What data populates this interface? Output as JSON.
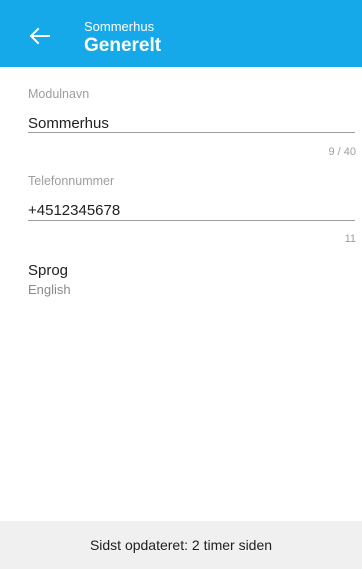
{
  "colors": {
    "appbar_background": "#16a9e9",
    "appbar_text": "#ffffff",
    "footer_background": "#f0f0f0"
  },
  "appbar": {
    "back_icon": "arrow-left-icon",
    "subtitle": "Sommerhus",
    "title": "Generelt"
  },
  "fields": {
    "module_name": {
      "label": "Modulnavn",
      "value": "Sommerhus",
      "counter": "9 / 40"
    },
    "phone_number": {
      "label": "Telefonnummer",
      "value": "+4512345678",
      "counter": "11"
    }
  },
  "language": {
    "title": "Sprog",
    "value": "English"
  },
  "footer": {
    "text": "Sidst opdateret: 2 timer siden"
  }
}
